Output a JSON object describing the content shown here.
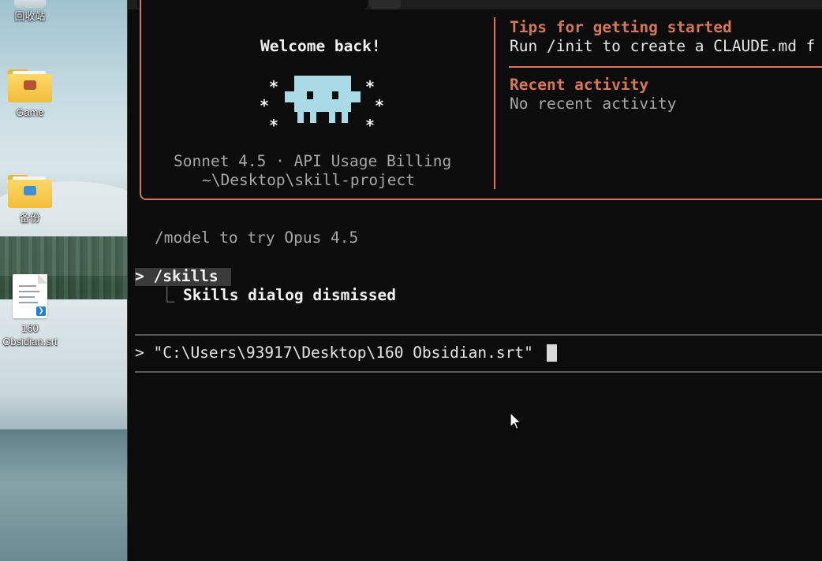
{
  "desktop": {
    "icons": [
      {
        "label": "回收站",
        "icon": "recycle-bin-icon"
      },
      {
        "label": "Game",
        "icon": "folder-icon"
      },
      {
        "label": "备份",
        "icon": "folder-icon"
      },
      {
        "label": "160\nObsidian.srt",
        "icon": "vscode-file-icon"
      }
    ]
  },
  "terminal": {
    "welcome": {
      "title": "Welcome back!",
      "model_line": "Sonnet 4.5 · API Usage Billing",
      "cwd": "~\\Desktop\\skill-project"
    },
    "tips": {
      "heading": "Tips for getting started",
      "body": "Run /init to create a CLAUDE.md f"
    },
    "recent": {
      "heading": "Recent activity",
      "body": "No recent activity"
    },
    "hint": "/model to try Opus 4.5",
    "command": "> /skills ",
    "command_result_prefix": "⎿",
    "command_result": "Skills dialog dismissed",
    "input_line": "> \"C:\\Users\\93917\\Desktop\\160 Obsidian.srt\""
  },
  "colors": {
    "accent": "#d77757",
    "mascot": "#a8dbe6",
    "background": "#0c0c0c"
  }
}
